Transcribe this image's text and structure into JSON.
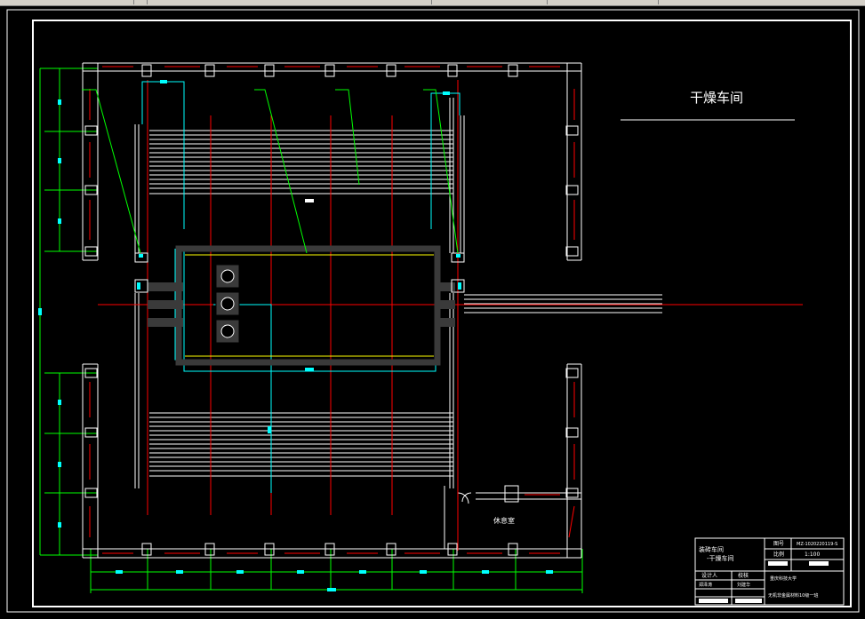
{
  "drawing": {
    "title": "干燥车间",
    "rest_room_label": "休息室",
    "colors": {
      "background": "#000000",
      "wall": "#ffffff",
      "axis": "#ff0000",
      "dimension": "#00ff00",
      "equipment": "#00ffff",
      "highlight": "#ffff00",
      "machine_body": "#3a3a3a"
    }
  },
  "title_block": {
    "project_line1": "装砖车间",
    "project_line2": "-干燥车间",
    "header_drawing_no": "图号",
    "drawing_no": "MZ-1020220119-S",
    "header_scale": "比例",
    "scale": "1:100",
    "designer_label": "设计人",
    "designer_name": "郑泽涛",
    "checker_label": "校核",
    "checker_name": "刘建华",
    "school": "重庆科技大学",
    "footer_note": "无机非金属材料10级一班"
  }
}
